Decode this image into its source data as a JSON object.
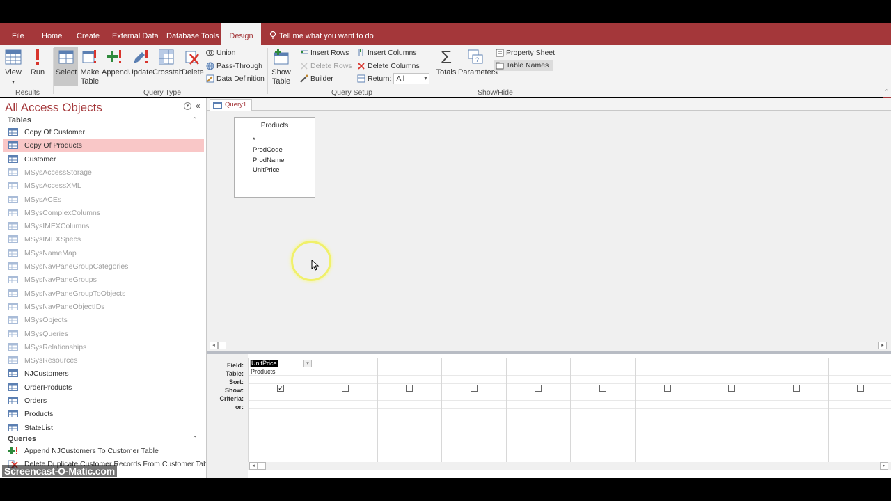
{
  "ribbon_tabs": [
    "File",
    "Home",
    "Create",
    "External Data",
    "Database Tools",
    "Design"
  ],
  "active_tab": "Design",
  "tell_me": "Tell me what you want to do",
  "ribbon": {
    "results": {
      "view": "View",
      "run": "Run",
      "group": "Results"
    },
    "query_type": {
      "select": "Select",
      "make_table_1": "Make",
      "make_table_2": "Table",
      "append": "Append",
      "update": "Update",
      "crosstab": "Crosstab",
      "delete": "Delete",
      "union": "Union",
      "pass_through": "Pass-Through",
      "data_definition": "Data Definition",
      "group": "Query Type"
    },
    "query_setup": {
      "show_table_1": "Show",
      "show_table_2": "Table",
      "insert_rows": "Insert Rows",
      "delete_rows": "Delete Rows",
      "builder": "Builder",
      "insert_columns": "Insert Columns",
      "delete_columns": "Delete Columns",
      "return_label": "Return:",
      "return_value": "All",
      "group": "Query Setup"
    },
    "show_hide": {
      "totals": "Totals",
      "parameters": "Parameters",
      "property_sheet": "Property Sheet",
      "table_names": "Table Names",
      "group": "Show/Hide"
    }
  },
  "nav": {
    "title": "All Access Objects",
    "tables_header": "Tables",
    "tables": [
      {
        "label": "Copy Of Customer",
        "system": false,
        "selected": false
      },
      {
        "label": "Copy Of Products",
        "system": false,
        "selected": true
      },
      {
        "label": "Customer",
        "system": false,
        "selected": false
      },
      {
        "label": "MSysAccessStorage",
        "system": true,
        "selected": false
      },
      {
        "label": "MSysAccessXML",
        "system": true,
        "selected": false
      },
      {
        "label": "MSysACEs",
        "system": true,
        "selected": false
      },
      {
        "label": "MSysComplexColumns",
        "system": true,
        "selected": false
      },
      {
        "label": "MSysIMEXColumns",
        "system": true,
        "selected": false
      },
      {
        "label": "MSysIMEXSpecs",
        "system": true,
        "selected": false
      },
      {
        "label": "MSysNameMap",
        "system": true,
        "selected": false
      },
      {
        "label": "MSysNavPaneGroupCategories",
        "system": true,
        "selected": false
      },
      {
        "label": "MSysNavPaneGroups",
        "system": true,
        "selected": false
      },
      {
        "label": "MSysNavPaneGroupToObjects",
        "system": true,
        "selected": false
      },
      {
        "label": "MSysNavPaneObjectIDs",
        "system": true,
        "selected": false
      },
      {
        "label": "MSysObjects",
        "system": true,
        "selected": false
      },
      {
        "label": "MSysQueries",
        "system": true,
        "selected": false
      },
      {
        "label": "MSysRelationships",
        "system": true,
        "selected": false
      },
      {
        "label": "MSysResources",
        "system": true,
        "selected": false
      },
      {
        "label": "NJCustomers",
        "system": false,
        "selected": false
      },
      {
        "label": "OrderProducts",
        "system": false,
        "selected": false
      },
      {
        "label": "Orders",
        "system": false,
        "selected": false
      },
      {
        "label": "Products",
        "system": false,
        "selected": false
      },
      {
        "label": "StateList",
        "system": false,
        "selected": false
      }
    ],
    "queries_header": "Queries",
    "queries": [
      {
        "label": "Append NJCustomers To Customer Table"
      },
      {
        "label": "Delete Duplicate Customer Records From Customer Table"
      }
    ]
  },
  "document": {
    "tab_label": "Query1",
    "field_list": {
      "title": "Products",
      "fields": [
        "*",
        "ProdCode",
        "ProdName",
        "UnitPrice"
      ]
    },
    "grid": {
      "row_labels": [
        "Field:",
        "Table:",
        "Sort:",
        "Show:",
        "Criteria:",
        "or:"
      ],
      "columns": [
        {
          "field": "UnitPrice",
          "table": "Products",
          "show": true
        },
        {
          "field": "",
          "table": "",
          "show": false
        },
        {
          "field": "",
          "table": "",
          "show": false
        },
        {
          "field": "",
          "table": "",
          "show": false
        },
        {
          "field": "",
          "table": "",
          "show": false
        },
        {
          "field": "",
          "table": "",
          "show": false
        },
        {
          "field": "",
          "table": "",
          "show": false
        },
        {
          "field": "",
          "table": "",
          "show": false
        },
        {
          "field": "",
          "table": "",
          "show": false
        },
        {
          "field": "",
          "table": "",
          "show": false
        }
      ]
    }
  },
  "watermark": "Screencast-O-Matic.com",
  "colors": {
    "accent": "#a4373a",
    "selected_item": "#f9c7c7"
  }
}
